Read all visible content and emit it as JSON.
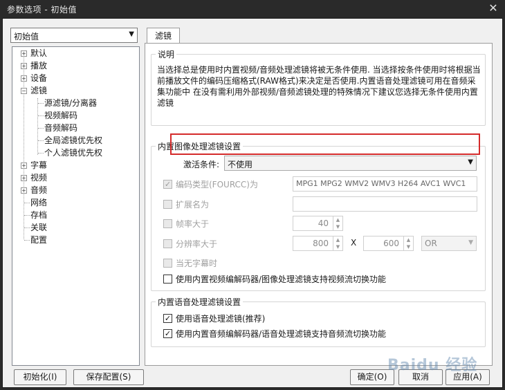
{
  "window": {
    "title": "参数选项 - 初始值"
  },
  "profile_select": {
    "value": "初始值"
  },
  "tree": {
    "items": [
      {
        "label": "默认",
        "expander": "+"
      },
      {
        "label": "播放",
        "expander": "+"
      },
      {
        "label": "设备",
        "expander": "+"
      },
      {
        "label": "滤镜",
        "expander": "-"
      },
      {
        "label": "源滤镜/分离器"
      },
      {
        "label": "视频解码"
      },
      {
        "label": "音频解码"
      },
      {
        "label": "全局滤镜优先权"
      },
      {
        "label": "个人滤镜优先权"
      },
      {
        "label": "字幕",
        "expander": "+"
      },
      {
        "label": "视频",
        "expander": "+"
      },
      {
        "label": "音频",
        "expander": "+"
      },
      {
        "label": "网络"
      },
      {
        "label": "存档"
      },
      {
        "label": "关联"
      },
      {
        "label": "配置"
      }
    ]
  },
  "tab": {
    "label": "滤镜"
  },
  "desc_group": {
    "title": "说明",
    "text": "当选择总是使用时内置视频/音频处理滤镜将被无条件使用. 当选择按条件使用时将根据当前播放文件的编码压缩格式(RAW格式)来决定是否使用.内置语音处理滤镜可用在音频采集功能中 在没有需利用外部视频/音频滤镜处理的特殊情况下建议您选择无条件使用内置滤镜"
  },
  "image_group": {
    "title": "内置图像处理滤镜设置",
    "activation_label": "激活条件:",
    "activation_value": "不使用",
    "fourcc_label": "编码类型(FOURCC)为",
    "fourcc_value": "MPG1 MPG2 WMV2 WMV3 H264 AVC1 WVC1",
    "extension_label": "扩展名为",
    "framerate_label": "帧率大于",
    "framerate_value": "40",
    "resolution_label": "分辨率大于",
    "res_w": "800",
    "res_x": "X",
    "res_h": "600",
    "res_op": "OR",
    "nosub_label": "当无字幕时",
    "switch_label": "使用内置视频编解码器/图像处理滤镜支持视频流切换功能"
  },
  "audio_group": {
    "title": "内置语音处理滤镜设置",
    "voice_label": "使用语音处理滤镜(推荐)",
    "audio_switch_label": "使用内置音频编解码器/语音处理滤镜支持音频流切换功能"
  },
  "footer": {
    "init_button": "初始化(I)",
    "save_button": "保存配置(S)",
    "ok_button": "确定(O)",
    "cancel_button": "取消",
    "apply_button": "应用(A)"
  },
  "watermark": "Baidu 经验",
  "colors": {
    "highlight": "#d42a2a",
    "titlebar": "#2a2a2a"
  }
}
